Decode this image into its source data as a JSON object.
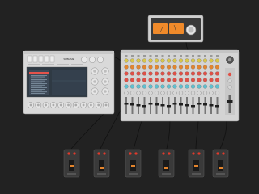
{
  "synth": {
    "title": "SUBLIME",
    "display_rows": 14
  },
  "mixer": {
    "channel_count": 16,
    "knob_row_colors": [
      "#d8c64a",
      "#e2852f",
      "#e05046",
      "#e05046",
      "#5fc0d0",
      "#d6d6d6"
    ]
  },
  "meter": {
    "meters": 2
  },
  "pedals": {
    "count": 6
  },
  "colors": {
    "background": "#222222",
    "panel": "#d8d8d8",
    "display": "#2f3a44",
    "cable": "#111111",
    "led_red": "#e23a2c",
    "meter_face": "#f08a2a"
  }
}
